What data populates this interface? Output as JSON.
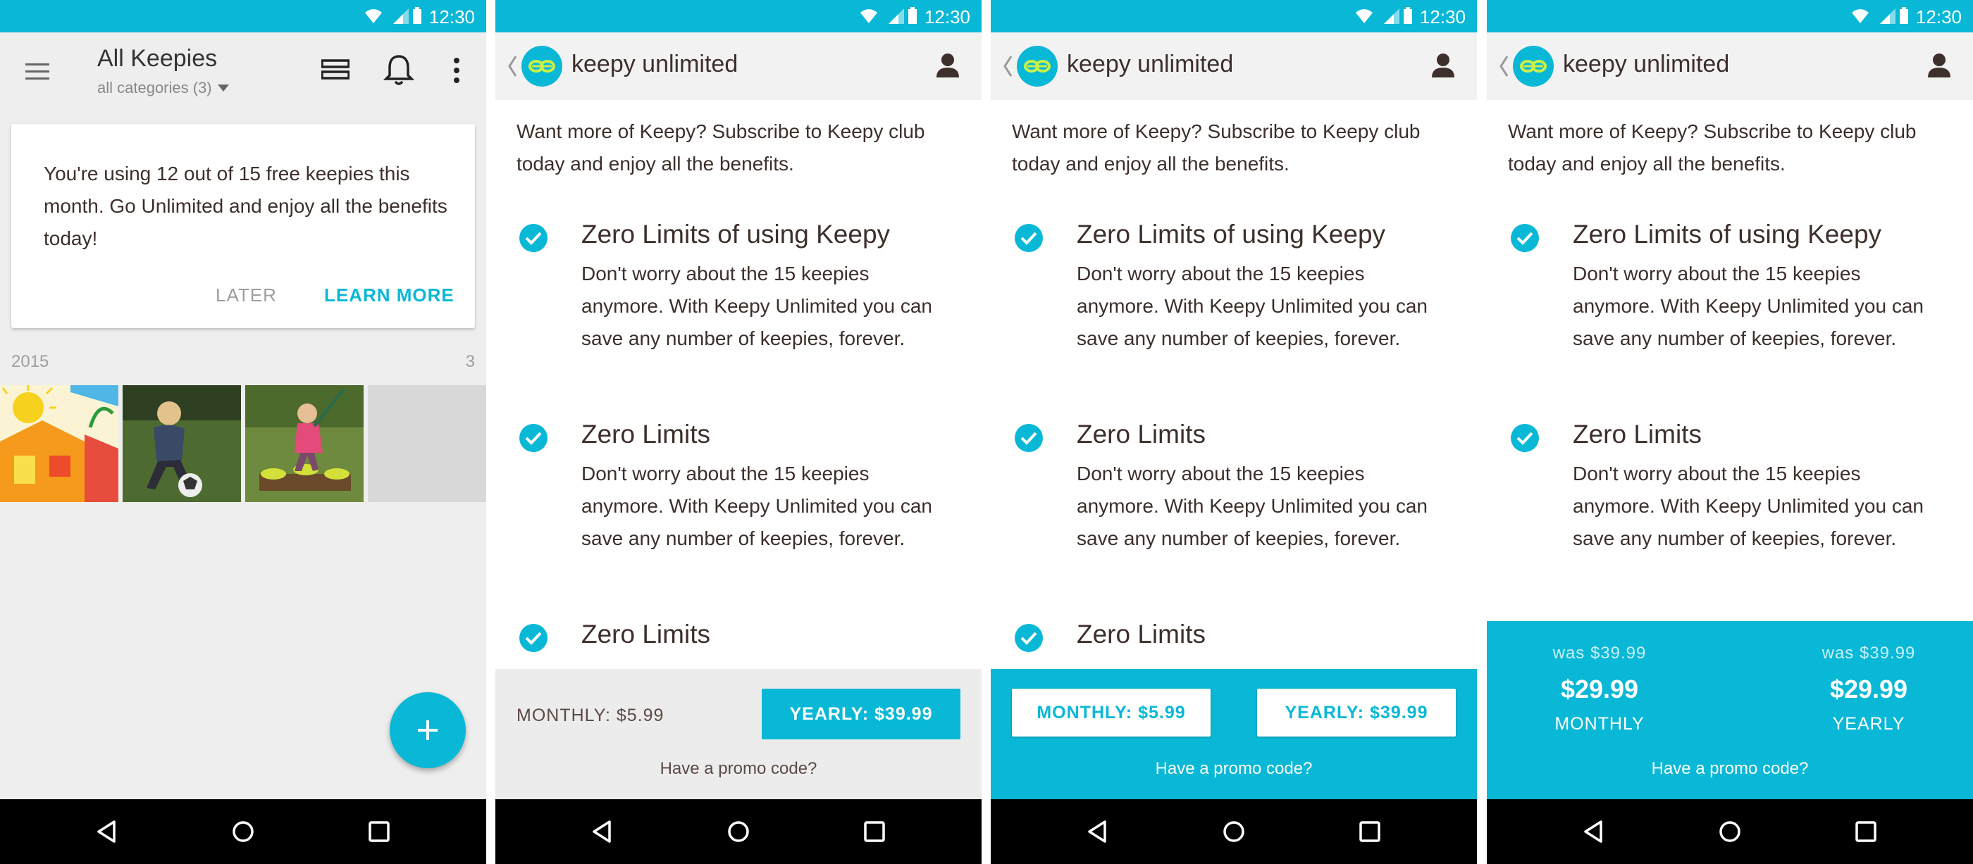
{
  "status": {
    "time": "12:30"
  },
  "screen1": {
    "title": "All Keepies",
    "subtitle": "all categories (3)",
    "card_text": "You're using 12 out of 15 free keepies this month. Go Unlimited and enjoy all the benefits today!",
    "later": "LATER",
    "learn_more": "LEARN MORE",
    "year": "2015",
    "count": "3"
  },
  "keepy": {
    "title": "keepy unlimited",
    "intro": "Want more of Keepy? Subscribe to Keepy club today and enjoy all the benefits.",
    "features": [
      {
        "title": "Zero Limits of using Keepy",
        "desc": "Don't worry about the 15 keepies anymore. With Keepy Unlimited you can save any number of keepies, forever."
      },
      {
        "title": "Zero Limits",
        "desc": "Don't worry about the 15 keepies anymore. With Keepy Unlimited you can save any number of keepies, forever."
      },
      {
        "title": "Zero Limits"
      }
    ],
    "monthly": "MONTHLY: $5.99",
    "yearly": "YEARLY: $39.99",
    "promo": "Have a promo code?",
    "pricing": {
      "monthly": {
        "was": "was $39.99",
        "now": "$29.99",
        "label": "MONTHLY"
      },
      "yearly": {
        "was": "was $39.99",
        "now": "$29.99",
        "label": "YEARLY"
      }
    }
  },
  "colors": {
    "accent": "#09b8d6",
    "text": "#3d2f2b",
    "logo_inner": "#c8f04a"
  },
  "icons": [
    "wifi-icon",
    "signal-icon",
    "battery-icon",
    "menu-icon",
    "list-view-icon",
    "bell-icon",
    "more-icon",
    "add-icon",
    "back-icon",
    "keepy-logo-icon",
    "user-icon",
    "check-circle-icon",
    "nav-back-icon",
    "nav-home-icon",
    "nav-recent-icon"
  ]
}
